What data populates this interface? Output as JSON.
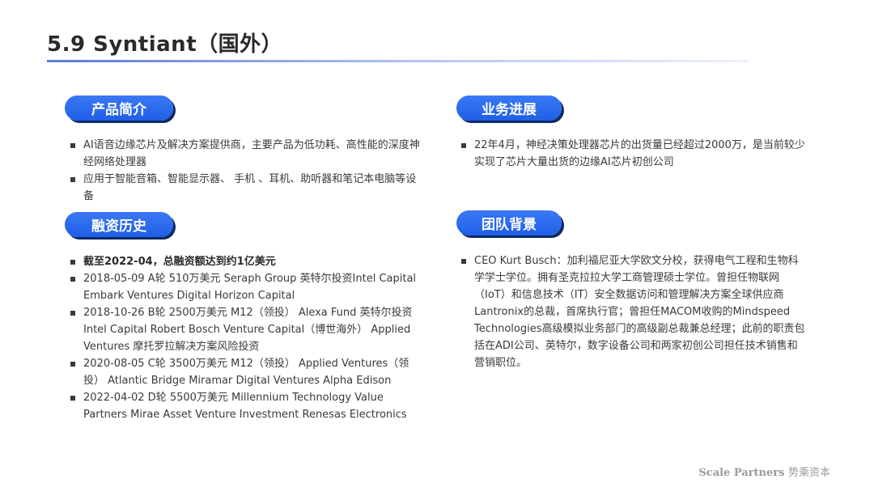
{
  "title": "5.9 Syntiant（国外）",
  "sections": {
    "product": {
      "heading": "产品简介",
      "items": [
        "AI语音边缘芯片及解决方案提供商，主要产品为低功耗、高性能的深度神经网络处理器",
        "应用于智能音箱、智能显示器、 手机 、耳机、助听器和笔记本电脑等设备"
      ]
    },
    "funding": {
      "heading": "融资历史",
      "items": [
        "截至2022-04，总融资额达到约1亿美元",
        "2018-05-09 A轮 510万美元 Seraph Group 英特尔投资Intel Capital Embark Ventures Digital Horizon Capital",
        "2018-10-26 B轮 2500万美元 M12（领投） Alexa Fund 英特尔投资 Intel Capital Robert Bosch Venture Capital（博世海外） Applied Ventures 摩托罗拉解决方案风险投资",
        "2020-08-05 C轮 3500万美元 M12（领投） Applied Ventures（领投） Atlantic Bridge Miramar Digital Ventures Alpha Edison",
        "2022-04-02 D轮 5500万美元 Millennium Technology Value Partners Mirae Asset Venture Investment Renesas Electronics"
      ]
    },
    "progress": {
      "heading": "业务进展",
      "items": [
        "22年4月，神经决策处理器芯片的出货量已经超过2000万，是当前较少实现了芯片大量出货的边缘AI芯片初创公司"
      ]
    },
    "team": {
      "heading": "团队背景",
      "items": [
        "CEO Kurt Busch：加利福尼亚大学欧文分校，获得电气工程和生物科学学士学位。拥有圣克拉拉大学工商管理硕士学位。曾担任物联网（IoT）和信息技术（IT）安全数据访问和管理解决方案全球供应商Lantronix的总裁，首席执行官；曾担任MACOM收购的Mindspeed Technologies高级模拟业务部门的高级副总裁兼总经理；此前的职责包括在ADI公司、英特尔，数字设备公司和两家初创公司担任技术销售和营销职位。"
      ]
    }
  },
  "footer": {
    "brand_en": "Scale Partners",
    "brand_cn": "势乘资本"
  }
}
